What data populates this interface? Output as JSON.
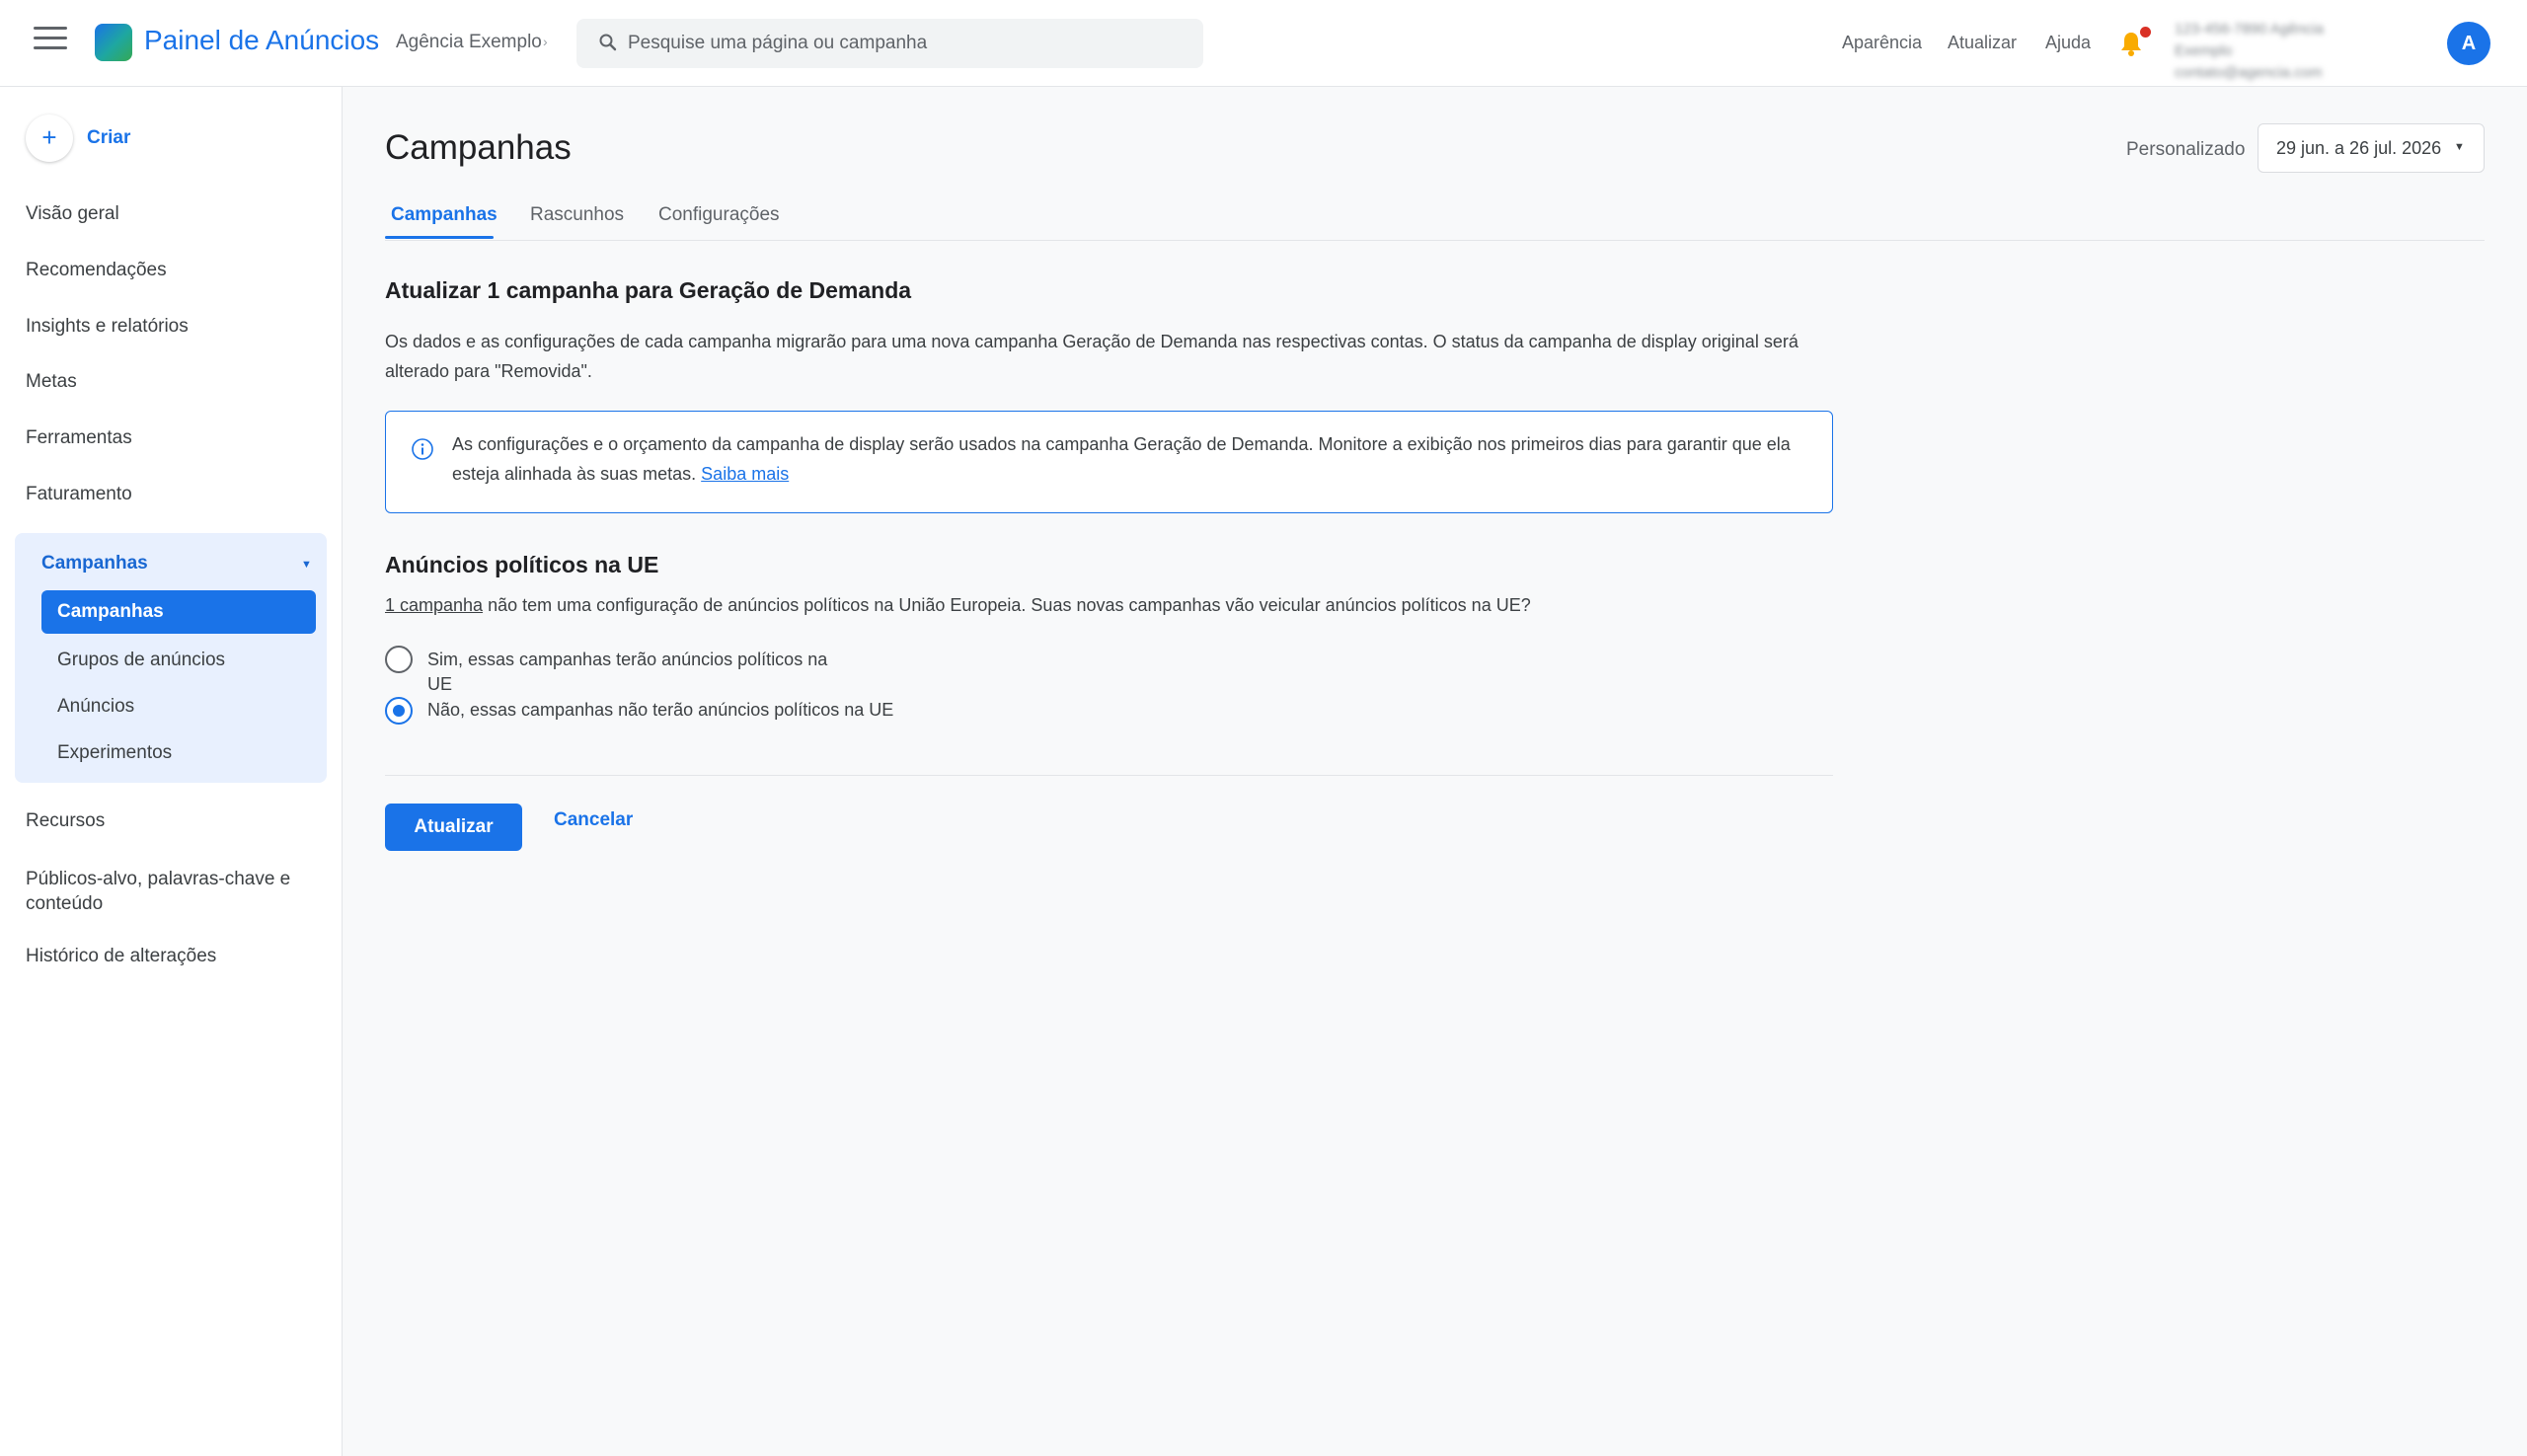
{
  "header": {
    "app_title": "Painel de Anúncios",
    "account_name": "Agência Exemplo",
    "search_placeholder": "Pesquise uma página ou campanha",
    "links": [
      "Aparência",
      "Atualizar",
      "Ajuda"
    ],
    "account_info_lines": [
      "123-456-7890 Agência",
      "Exemplo",
      "contato@agencia.com"
    ],
    "avatar_letter": "A",
    "accent_color": "#1a73e8",
    "notification_dot_color": "#d93025"
  },
  "sidebar": {
    "create_label": "Criar",
    "items_top": [
      "Visão geral",
      "Recomendações",
      "Insights e relatórios",
      "Metas",
      "Ferramentas",
      "Faturamento"
    ],
    "group": {
      "label": "Campanhas",
      "active_item": "Campanhas",
      "items": [
        "Grupos de anúncios",
        "Anúncios",
        "Experimentos"
      ]
    },
    "items_bottom": [
      "Recursos",
      "Públicos-alvo, palavras-chave e conteúdo",
      "Histórico de alterações"
    ]
  },
  "main": {
    "page_title": "Campanhas",
    "date_range": {
      "label": "Personalizado",
      "value": "29 jun. a 26 jul. 2026"
    },
    "tabs": [
      {
        "label": "Campanhas",
        "active": true
      },
      {
        "label": "Rascunhos",
        "active": false
      },
      {
        "label": "Configurações",
        "active": false
      }
    ],
    "update": {
      "title": "Atualizar 1 campanha para Geração de Demanda",
      "description": "Os dados e as configurações de cada campanha migrarão para uma nova campanha Geração de Demanda nas respectivas contas. O status da campanha de display original será alterado para \"Removida\".",
      "info_text": "As configurações e o orçamento da campanha de display serão usados na campanha Geração de Demanda. Monitore a exibição nos primeiros dias para garantir que ela esteja alinhada às suas metas.",
      "info_link": "Saiba mais"
    },
    "political": {
      "title": "Anúncios políticos na UE",
      "question_link": "1 campanha",
      "question_text": " não tem uma configuração de anúncios políticos na União Europeia. Suas novas campanhas vão veicular anúncios políticos na UE?",
      "options": [
        {
          "label": "Sim, essas campanhas terão anúncios políticos na UE",
          "selected": false
        },
        {
          "label": "Não, essas campanhas não terão anúncios políticos na UE",
          "selected": true
        }
      ]
    },
    "actions": {
      "primary": "Atualizar",
      "secondary": "Cancelar"
    }
  }
}
